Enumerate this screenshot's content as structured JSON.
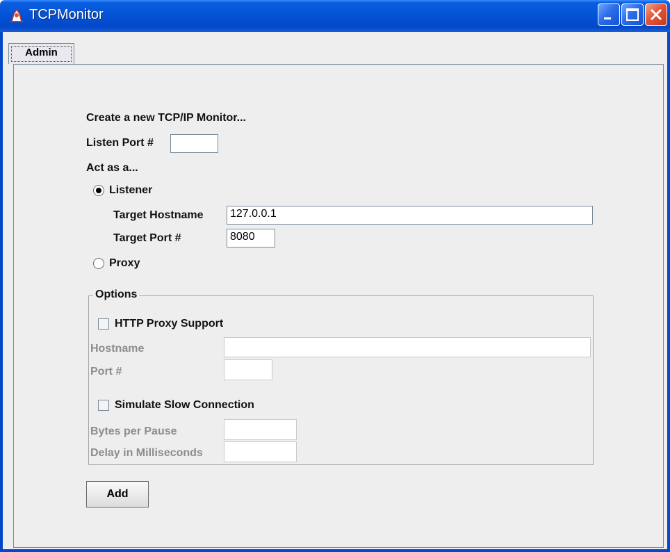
{
  "window": {
    "title": "TCPMonitor",
    "accent": "#0348c8"
  },
  "tabs": [
    {
      "label": "Admin",
      "selected": true
    }
  ],
  "form": {
    "heading": "Create a new TCP/IP Monitor...",
    "listen_port_label": "Listen Port #",
    "listen_port_value": "",
    "act_as_label": "Act as a...",
    "listener_label": "Listener",
    "listener_selected": true,
    "target_hostname_label": "Target Hostname",
    "target_hostname_value": "127.0.0.1",
    "target_port_label": "Target Port #",
    "target_port_value": "8080",
    "proxy_label": "Proxy",
    "proxy_selected": false
  },
  "options": {
    "title": "Options",
    "http_proxy_support_label": "HTTP Proxy Support",
    "http_proxy_support_checked": false,
    "hostname_label": "Hostname",
    "hostname_value": "",
    "port_label": "Port #",
    "port_value": "",
    "simulate_slow_label": "Simulate Slow Connection",
    "simulate_slow_checked": false,
    "bytes_per_pause_label": "Bytes per Pause",
    "bytes_per_pause_value": "",
    "delay_label": "Delay in Milliseconds",
    "delay_value": ""
  },
  "buttons": {
    "add_label": "Add"
  },
  "icons": {
    "app": "duke-icon",
    "minimize": "minimize-icon",
    "maximize": "maximize-icon",
    "close": "close-icon"
  }
}
